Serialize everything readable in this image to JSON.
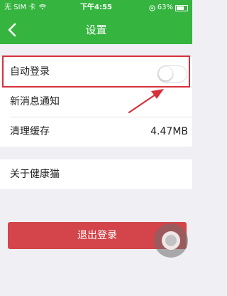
{
  "status_bar": {
    "carrier": "无 SIM 卡",
    "time": "下午4:55",
    "battery": "63%",
    "battery_level": 0.63
  },
  "nav": {
    "title": "设置",
    "back_icon": "chevron-left-icon"
  },
  "settings": {
    "auto_login": {
      "label": "自动登录",
      "enabled": false
    },
    "new_message_notify": {
      "label": "新消息通知"
    },
    "clear_cache": {
      "label": "清理缓存",
      "value": "4.47MB"
    },
    "about": {
      "label": "关于健康猫"
    }
  },
  "logout_label": "退出登录",
  "colors": {
    "header": "#35b43f",
    "logout": "#d3454a",
    "highlight": "#d6313a"
  }
}
